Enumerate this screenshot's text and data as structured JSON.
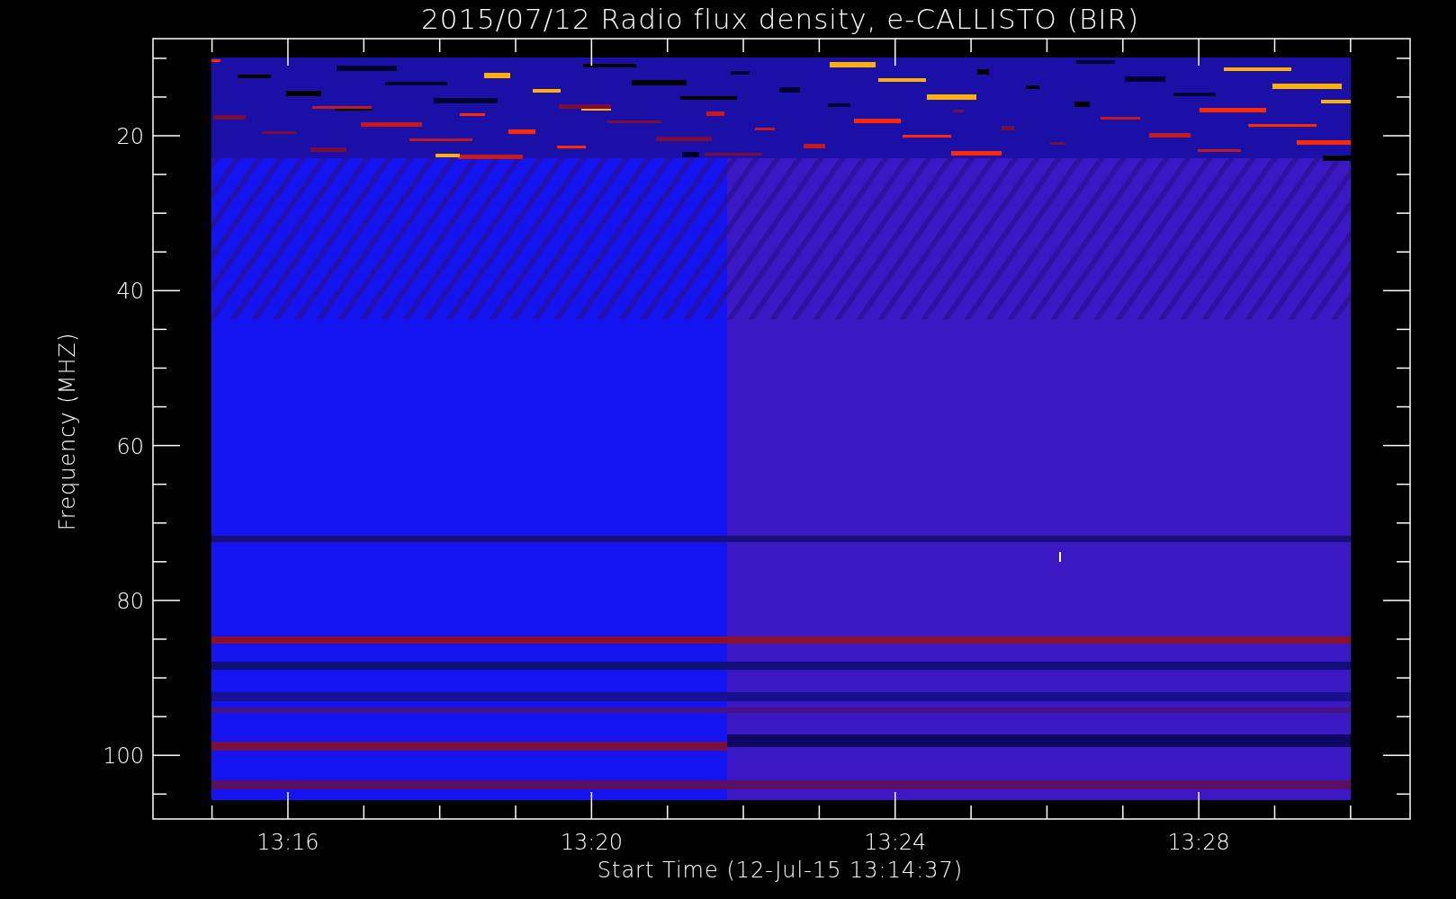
{
  "title": "2015/07/12  Radio flux density, e-CALLISTO (BIR)",
  "y_axis": {
    "label": "Frequency (MHZ)",
    "ticks": [
      "20",
      "40",
      "60",
      "80",
      "100"
    ]
  },
  "x_axis": {
    "label": "Start Time (12-Jul-15 13:14:37)",
    "ticks": [
      "13:16",
      "13:20",
      "13:24",
      "13:28"
    ]
  }
}
